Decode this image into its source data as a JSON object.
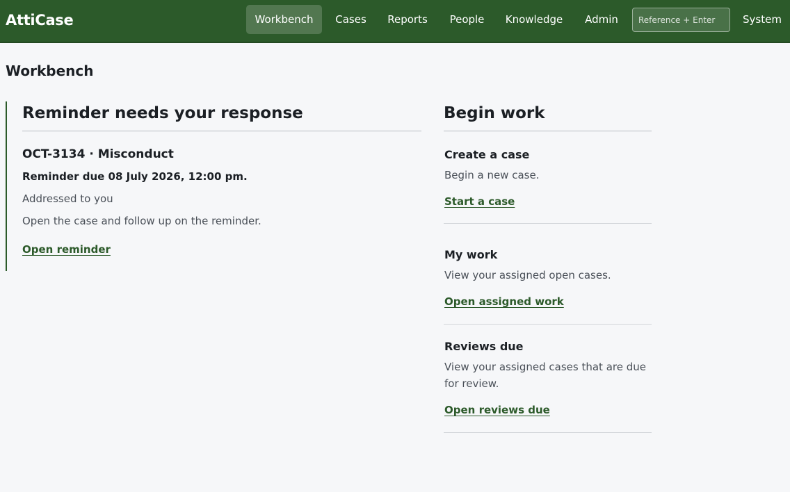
{
  "app": {
    "brand": "AttiCase"
  },
  "nav": {
    "items": [
      {
        "label": "Workbench"
      },
      {
        "label": "Cases"
      },
      {
        "label": "Reports"
      },
      {
        "label": "People"
      },
      {
        "label": "Knowledge"
      },
      {
        "label": "Admin"
      }
    ],
    "active": "Workbench",
    "reference_placeholder": "Reference + Enter",
    "reference_value": "",
    "system_label": "System"
  },
  "page": {
    "title": "Workbench"
  },
  "reminder": {
    "heading": "Reminder needs your response",
    "case_ref": "OCT-3134 · Misconduct",
    "due": "Reminder due 08 July 2026, 12:00 pm.",
    "addressed": "Addressed to you",
    "instruction": "Open the case and follow up on the reminder.",
    "link": "Open reminder"
  },
  "begin_work": {
    "heading": "Begin work",
    "cards": [
      {
        "title": "Create a case",
        "description": "Begin a new case.",
        "link": "Start a case"
      },
      {
        "title": "My work",
        "description": "View your assigned open cases.",
        "link": "Open assigned work"
      },
      {
        "title": "Reviews due",
        "description": "View your assigned cases that are due for review.",
        "link": "Open reviews due"
      }
    ]
  },
  "colors": {
    "topbar": "#2c5a2a",
    "accent": "#2c5a2a",
    "background": "#f6f7f9"
  }
}
